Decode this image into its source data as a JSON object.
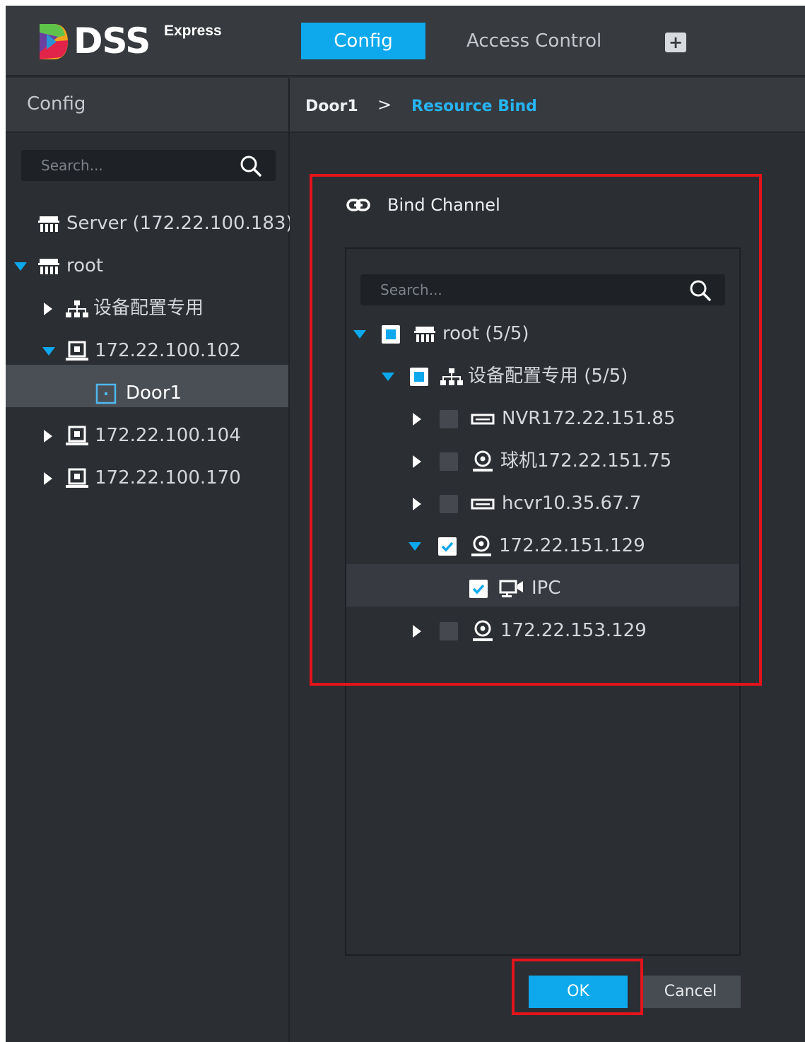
{
  "app": {
    "logo_text": "DSS",
    "logo_sup": "Express"
  },
  "topbar": {
    "tabs": [
      {
        "label": "Config",
        "active": true
      },
      {
        "label": "Access Control",
        "active": false
      }
    ],
    "add_tab_icon": "plus-icon"
  },
  "sidebar": {
    "title": "Config",
    "search_placeholder": "Search...",
    "tree": [
      {
        "label": "Server (172.22.100.183)",
        "icon": "server-icon"
      },
      {
        "label": "root",
        "icon": "org-icon",
        "expanded": true
      },
      {
        "label": "设备配置专用",
        "icon": "hierarchy-icon",
        "expanded": false
      },
      {
        "label": "172.22.100.102",
        "icon": "controller-icon",
        "expanded": true
      },
      {
        "label": "Door1",
        "icon": "door-icon",
        "selected": true
      },
      {
        "label": "172.22.100.104",
        "icon": "controller-icon",
        "expanded": false
      },
      {
        "label": "172.22.100.170",
        "icon": "controller-icon",
        "expanded": false
      }
    ]
  },
  "breadcrumb": {
    "parent": "Door1",
    "separator": ">",
    "current": "Resource Bind"
  },
  "bind": {
    "title": "Bind Channel",
    "search_placeholder": "Search...",
    "tree": [
      {
        "label": "root (5/5)",
        "icon": "org-icon",
        "check": "partial",
        "expanded": true
      },
      {
        "label": "设备配置专用 (5/5)",
        "icon": "hierarchy-icon",
        "check": "partial",
        "expanded": true
      },
      {
        "label": "NVR172.22.151.85",
        "icon": "nvr-icon",
        "check": "unchecked",
        "expanded": false
      },
      {
        "label": "球机172.22.151.75",
        "icon": "camera-icon",
        "check": "unchecked",
        "expanded": false
      },
      {
        "label": "hcvr10.35.67.7",
        "icon": "nvr-icon",
        "check": "unchecked",
        "expanded": false
      },
      {
        "label": "172.22.151.129",
        "icon": "camera-icon",
        "check": "checked",
        "expanded": true
      },
      {
        "label": "IPC",
        "icon": "ipc-channel-icon",
        "check": "checked"
      },
      {
        "label": "172.22.153.129",
        "icon": "camera-icon",
        "check": "unchecked",
        "expanded": false
      }
    ],
    "ok_label": "OK",
    "cancel_label": "Cancel"
  },
  "colors": {
    "accent": "#0ea8ec",
    "highlight_box": "#e3141b",
    "background": "#2b2e33"
  }
}
